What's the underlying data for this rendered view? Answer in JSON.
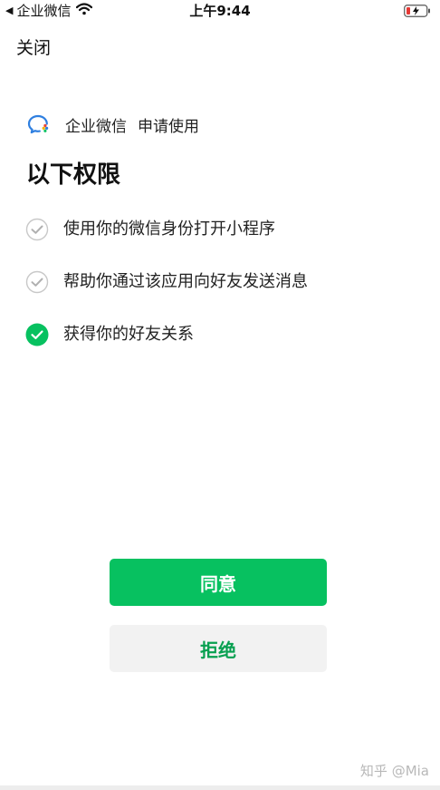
{
  "status_bar": {
    "back_label": "企业微信",
    "time": "上午9:44",
    "icons": [
      "back-arrow-icon",
      "wifi-icon",
      "battery-low-charging-icon"
    ]
  },
  "header": {
    "close_label": "关闭"
  },
  "request": {
    "app_name": "企业微信",
    "action": "申请使用",
    "app_icon": "wecom-logo-icon"
  },
  "permissions": {
    "title": "以下权限",
    "items": [
      {
        "label": "使用你的微信身份打开小程序",
        "checked": false,
        "status": "default-granted"
      },
      {
        "label": "帮助你通过该应用向好友发送消息",
        "checked": false,
        "status": "default-granted"
      },
      {
        "label": "获得你的好友关系",
        "checked": true,
        "status": "selected"
      }
    ]
  },
  "actions": {
    "agree_label": "同意",
    "reject_label": "拒绝"
  },
  "watermark": "知乎 @Mia",
  "colors": {
    "accent_green": "#07c160",
    "reject_text_green": "#07a050",
    "reject_bg": "#f2f2f2",
    "battery_red": "#e53935",
    "check_gray": "#c8c8c8"
  }
}
